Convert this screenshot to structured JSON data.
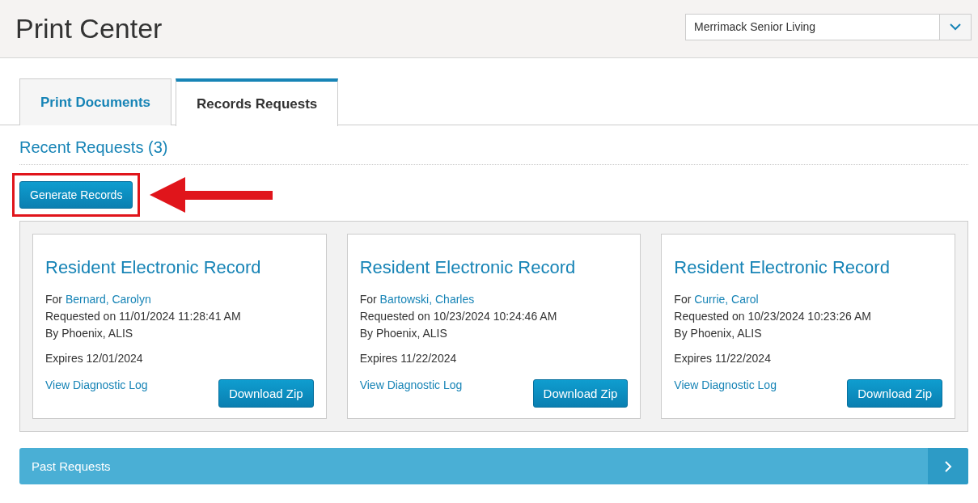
{
  "header": {
    "title": "Print Center",
    "community_select": {
      "value": "Merrimack Senior Living"
    }
  },
  "tabs": [
    {
      "label": "Print Documents",
      "selected": false
    },
    {
      "label": "Records Requests",
      "selected": true
    }
  ],
  "section": {
    "heading": "Recent Requests (3)"
  },
  "generate_button": {
    "label": "Generate Records",
    "highlighted": true
  },
  "requests": [
    {
      "title": "Resident Electronic Record",
      "for_label": "For",
      "resident": "Bernard, Carolyn",
      "requested": "Requested on 11/01/2024 11:28:41 AM",
      "by": "By Phoenix, ALIS",
      "expires": "Expires 12/01/2024",
      "log_link": "View Diagnostic Log",
      "download": "Download Zip"
    },
    {
      "title": "Resident Electronic Record",
      "for_label": "For",
      "resident": "Bartowski, Charles",
      "requested": "Requested on 10/23/2024 10:24:46 AM",
      "by": "By Phoenix, ALIS",
      "expires": "Expires 11/22/2024",
      "log_link": "View Diagnostic Log",
      "download": "Download Zip"
    },
    {
      "title": "Resident Electronic Record",
      "for_label": "For",
      "resident": "Currie, Carol",
      "requested": "Requested on 10/23/2024 10:23:26 AM",
      "by": "By Phoenix, ALIS",
      "expires": "Expires 11/22/2024",
      "log_link": "View Diagnostic Log",
      "download": "Download Zip"
    }
  ],
  "past_requests": {
    "label": "Past Requests",
    "expanded": false
  }
}
